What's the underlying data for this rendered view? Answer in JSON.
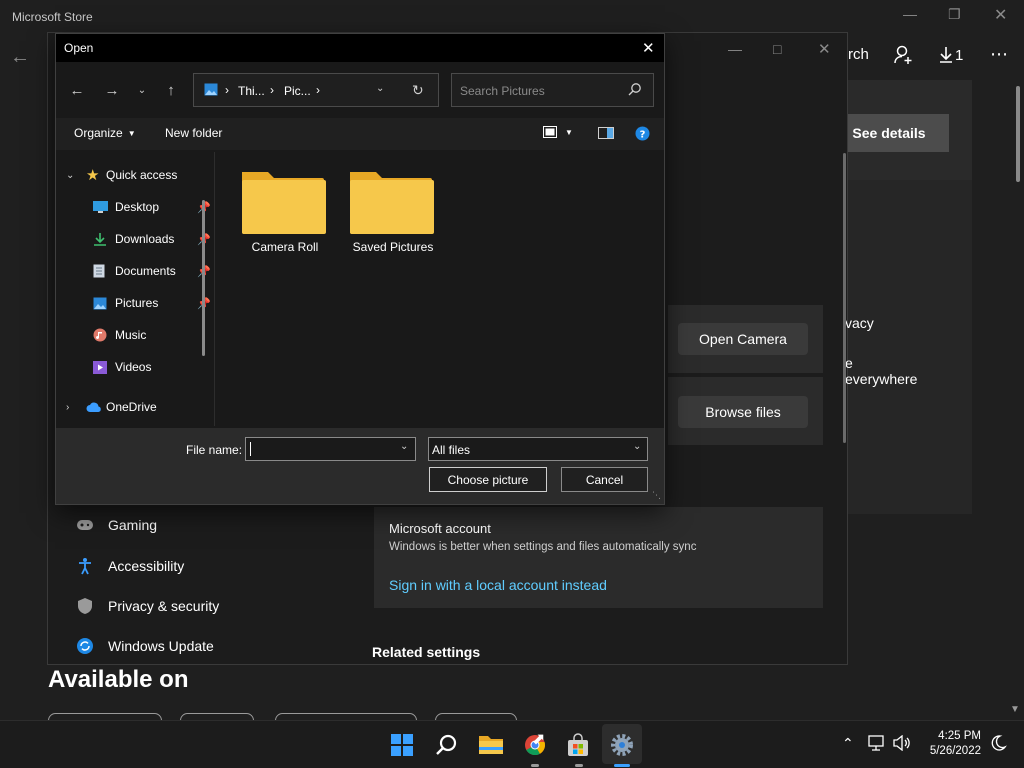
{
  "store": {
    "title": "Microsoft Store",
    "search_partial": "rch",
    "downloads_label": "1",
    "see_details": "See details",
    "available_on": "Available on"
  },
  "settings": {
    "open_camera": "Open Camera",
    "browse_files": "Browse files",
    "partial_privacy": "vacy",
    "partial_everywhere": "e everywhere",
    "nav": [
      {
        "label": "Gaming",
        "icon": "gaming-icon"
      },
      {
        "label": "Accessibility",
        "icon": "accessibility-icon"
      },
      {
        "label": "Privacy & security",
        "icon": "shield-icon"
      },
      {
        "label": "Windows Update",
        "icon": "windows-update-icon"
      }
    ],
    "account": {
      "title": "Microsoft account",
      "subtitle": "Windows is better when settings and files automatically sync",
      "link": "Sign in with a local account instead"
    },
    "related_settings": "Related settings"
  },
  "dialog": {
    "title": "Open",
    "breadcrumb": [
      "Thi...",
      "Pic..."
    ],
    "search_placeholder": "Search Pictures",
    "toolbar": {
      "organize": "Organize",
      "new_folder": "New folder"
    },
    "tree": {
      "quick_access": "Quick access",
      "items": [
        {
          "label": "Desktop",
          "icon": "desktop-icon",
          "pinned": true
        },
        {
          "label": "Downloads",
          "icon": "download-icon",
          "pinned": true
        },
        {
          "label": "Documents",
          "icon": "document-icon",
          "pinned": true
        },
        {
          "label": "Pictures",
          "icon": "pictures-icon",
          "pinned": true
        },
        {
          "label": "Music",
          "icon": "music-icon",
          "pinned": false
        },
        {
          "label": "Videos",
          "icon": "videos-icon",
          "pinned": false
        }
      ],
      "onedrive": "OneDrive"
    },
    "folders": [
      {
        "label": "Camera Roll"
      },
      {
        "label": "Saved Pictures"
      }
    ],
    "file_name_label": "File name:",
    "file_name_value": "",
    "file_type": "All files",
    "choose_button": "Choose picture",
    "cancel_button": "Cancel"
  },
  "taskbar": {
    "time": "4:25 PM",
    "date": "5/26/2022"
  },
  "colors": {
    "accent": "#0078d4",
    "link": "#60cdff",
    "folder": "#f6c84b",
    "see_details_bg": "#4c4c4c"
  }
}
